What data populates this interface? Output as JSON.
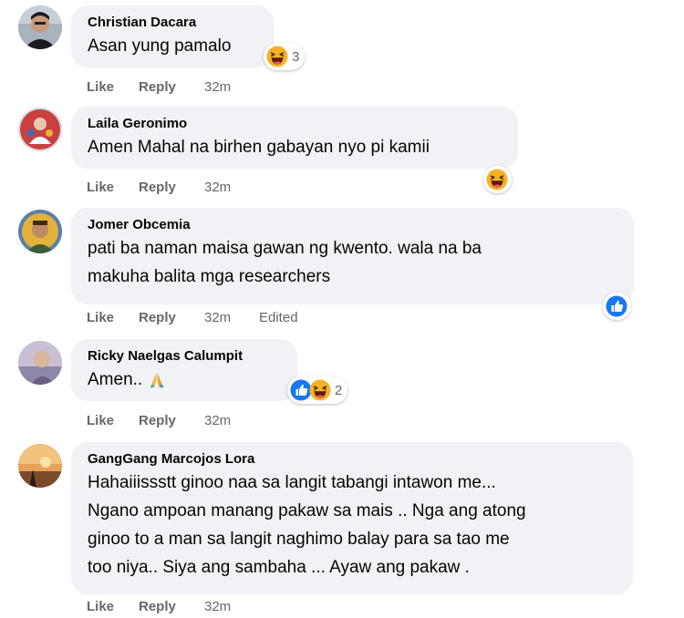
{
  "comments": [
    {
      "author": "Christian Dacara",
      "lines": [
        "Asan yung pamalo"
      ],
      "reaction_icons": [
        "haha-icon"
      ],
      "reaction_count": "3",
      "actions": {
        "like": "Like",
        "reply": "Reply",
        "time": "32m"
      }
    },
    {
      "author": "Laila Geronimo",
      "lines": [
        "Amen Mahal na birhen gabayan nyo pi kamii"
      ],
      "reaction_icons": [
        "haha-icon"
      ],
      "reaction_count": "",
      "actions": {
        "like": "Like",
        "reply": "Reply",
        "time": "32m"
      }
    },
    {
      "author": "Jomer Obcemia",
      "lines": [
        "pati ba naman maisa gawan ng kwento. wala na ba",
        "makuha balita mga researchers"
      ],
      "reaction_icons": [
        "like-icon"
      ],
      "reaction_count": "",
      "actions": {
        "like": "Like",
        "reply": "Reply",
        "time": "32m",
        "edited": "Edited"
      }
    },
    {
      "author": "Ricky Naelgas Calumpit",
      "lines": [
        "Amen.."
      ],
      "inline_emoji": "folded-hands-icon",
      "reaction_icons": [
        "like-icon",
        "haha-icon"
      ],
      "reaction_count": "2",
      "actions": {
        "like": "Like",
        "reply": "Reply",
        "time": "32m"
      }
    },
    {
      "author": "GangGang Marcojos Lora",
      "lines": [
        "Hahaiiissstt ginoo naa sa langit tabangi intawon me...",
        "Ngano ampoan manang pakaw sa mais .. Nga ang atong",
        "ginoo to a man sa langit naghimo balay para sa tao me",
        "too niya.. Siya ang sambaha ... Ayaw ang pakaw ."
      ],
      "reaction_icons": [],
      "reaction_count": "",
      "actions": {
        "like": "Like",
        "reply": "Reply",
        "time": "32m"
      }
    }
  ],
  "colors": {
    "bubble": "#f0f2f5",
    "text": "#050505",
    "meta": "#65676b",
    "like_blue": "#1877f2",
    "haha_yellow": "#f7b125"
  }
}
